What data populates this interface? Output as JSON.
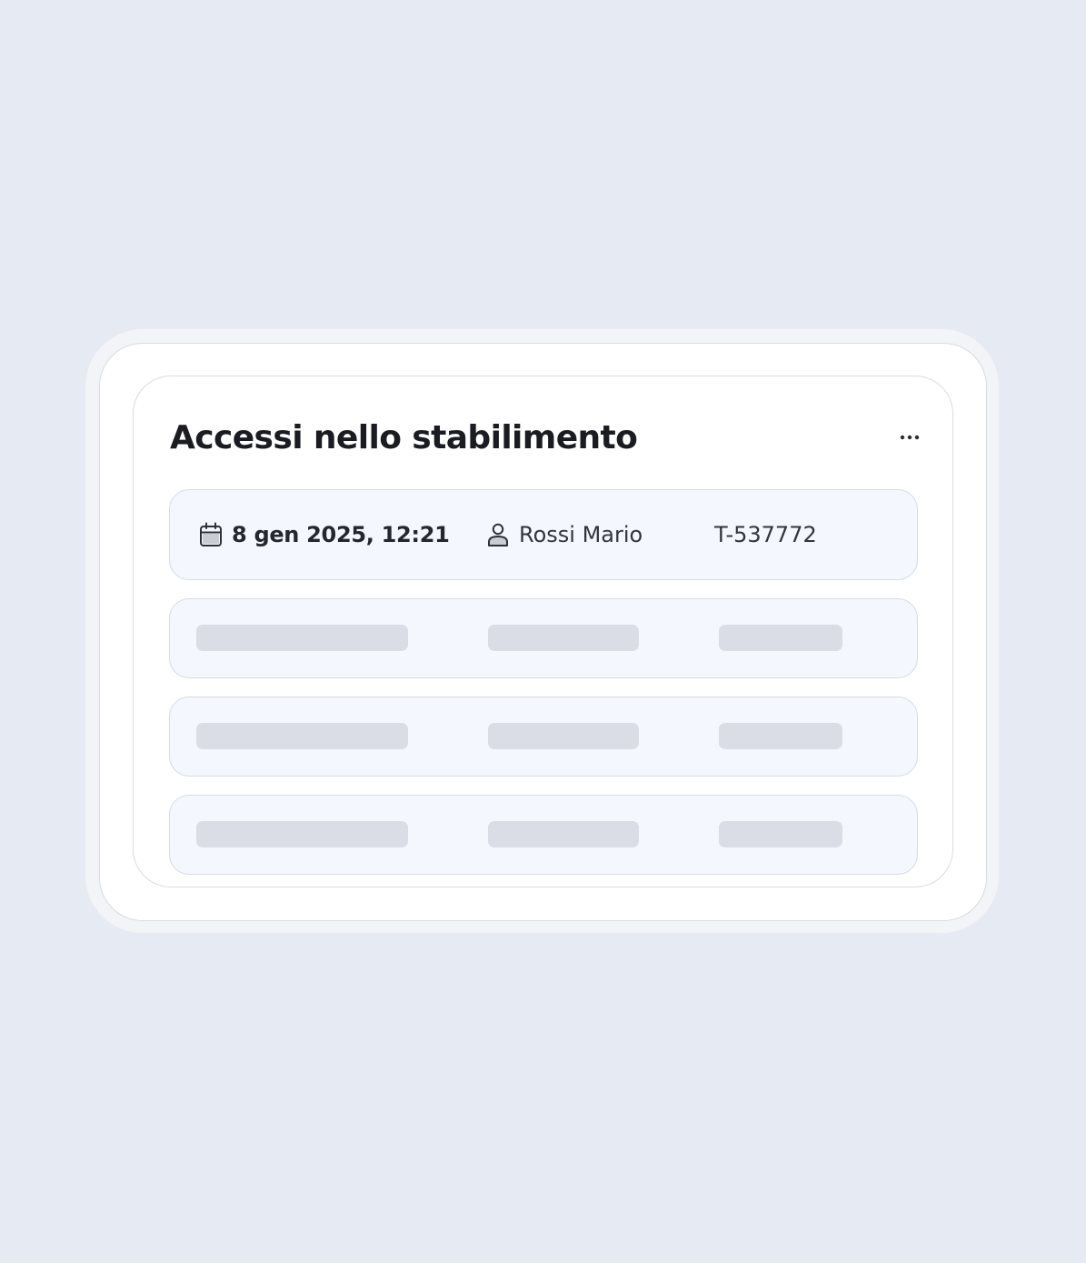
{
  "card": {
    "title": "Accessi nello stabilimento",
    "menu_icon": "more-horizontal-icon"
  },
  "entries": [
    {
      "date_icon": "calendar-icon",
      "datetime": "8 gen 2025, 12:21",
      "person_icon": "user-icon",
      "person": "Rossi Mario",
      "badge": "T-537772"
    }
  ],
  "loading_rows": 3,
  "colors": {
    "background": "#e6eaf3",
    "row_background": "#f4f7fd",
    "skeleton": "#dadde5",
    "title_text": "#1b1c22"
  }
}
